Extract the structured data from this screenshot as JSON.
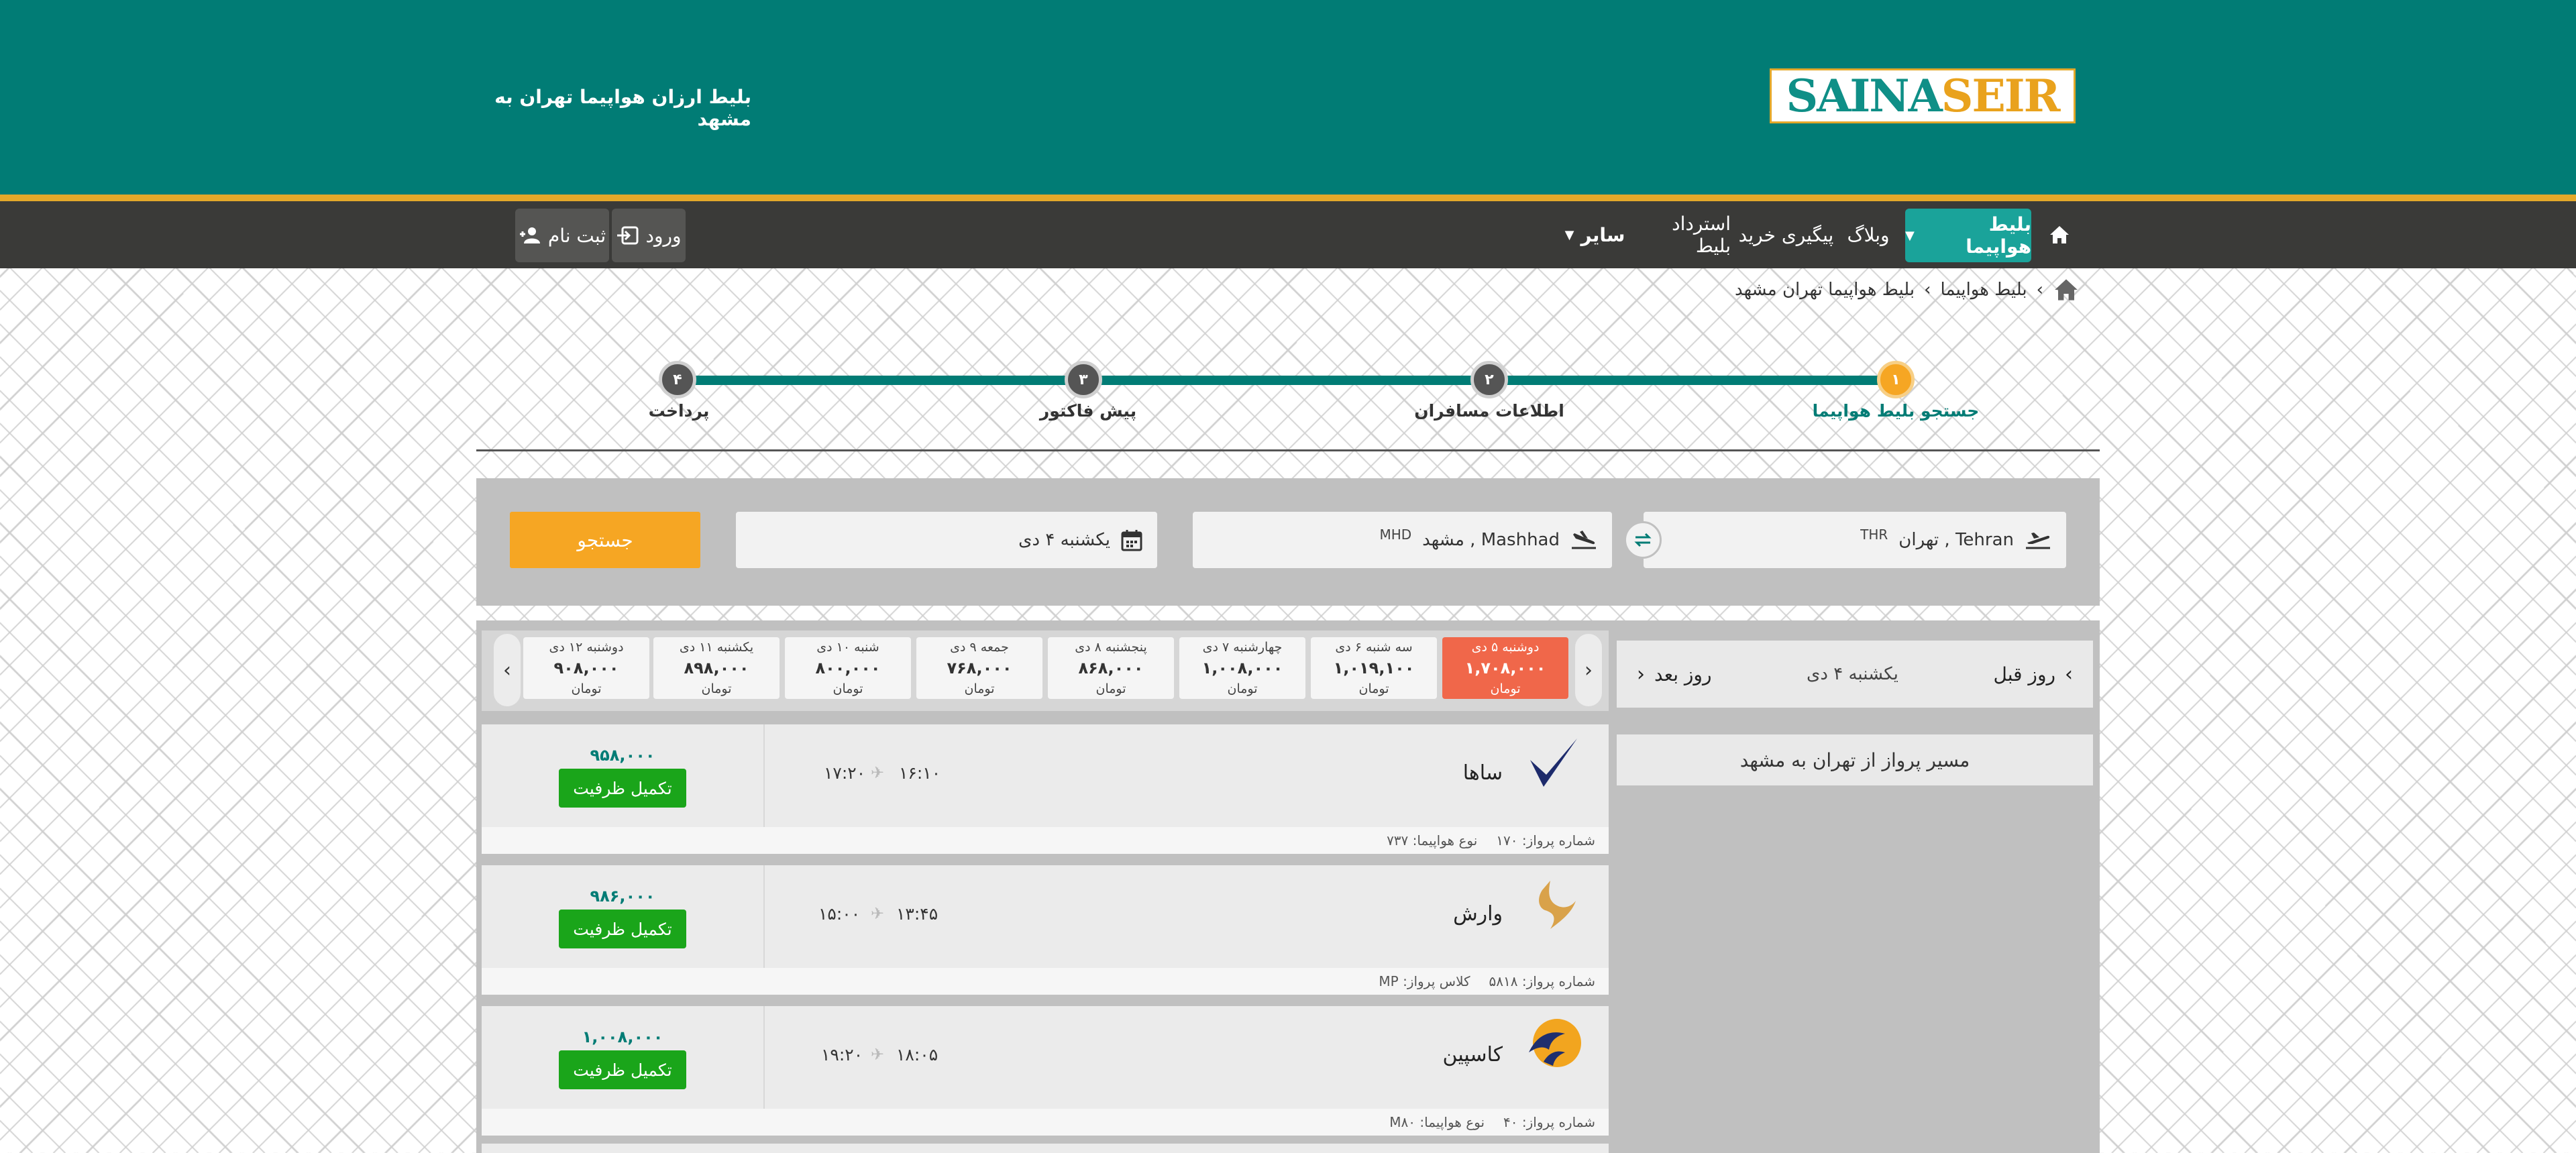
{
  "header": {
    "logo_left": "SAINA",
    "logo_right": "SEIR",
    "page_title": "بلیط ارزان هواپیما تهران به مشهد",
    "colors": {
      "primary": "#017c75",
      "accent": "#f6a623",
      "stripe": "#e3a82a"
    }
  },
  "nav": {
    "home_icon": "home-icon",
    "flight_ticket": "بلیط هواپیما",
    "blog": "وبلاگ",
    "track_purchase": "پیگیری خرید",
    "refund": "استرداد بلیط",
    "other": "سایر",
    "login": "ورود",
    "register": "ثبت نام"
  },
  "breadcrumb": {
    "level1": "بلیط هواپیما",
    "level2": "بلیط هواپیما تهران مشهد"
  },
  "stepper": {
    "steps": [
      {
        "num": "۱",
        "label": "جستجو بلیط هواپیما",
        "active": true
      },
      {
        "num": "۲",
        "label": "اطلاعات مسافران",
        "active": false
      },
      {
        "num": "۳",
        "label": "پیش فاکتور",
        "active": false
      },
      {
        "num": "۴",
        "label": "پرداخت",
        "active": false
      }
    ]
  },
  "search": {
    "origin": "Tehran , تهران",
    "origin_code": "THR",
    "destination": "Mashhad , مشهد",
    "destination_code": "MHD",
    "date": "یکشنبه ۴ دی",
    "button": "جستجو"
  },
  "sidebar": {
    "prev_day": "روز قبل",
    "current_day": "یکشنبه ۴ دی",
    "next_day": "روز بعد",
    "route": "مسیر پرواز از تهران به مشهد"
  },
  "date_strip": {
    "currency": "تومان",
    "days": [
      {
        "label": "دوشنبه ۵ دی",
        "price": "۱,۷۰۸,۰۰۰",
        "selected": true
      },
      {
        "label": "سه شنبه ۶ دی",
        "price": "۱,۰۱۹,۱۰۰",
        "selected": false
      },
      {
        "label": "چهارشنبه ۷ دی",
        "price": "۱,۰۰۸,۰۰۰",
        "selected": false
      },
      {
        "label": "پنجشنبه ۸ دی",
        "price": "۸۶۸,۰۰۰",
        "selected": false
      },
      {
        "label": "جمعه ۹ دی",
        "price": "۷۶۸,۰۰۰",
        "selected": false
      },
      {
        "label": "شنبه ۱۰ دی",
        "price": "۸۰۰,۰۰۰",
        "selected": false
      },
      {
        "label": "یکشنبه ۱۱ دی",
        "price": "۸۹۸,۰۰۰",
        "selected": false
      },
      {
        "label": "دوشنبه ۱۲ دی",
        "price": "۹۰۸,۰۰۰",
        "selected": false
      }
    ]
  },
  "flights": [
    {
      "airline": "ساها",
      "logo_icon": "saha-logo-icon",
      "depart": "۱۶:۱۰",
      "arrive": "۱۷:۲۰",
      "price": "۹۵۸,۰۰۰",
      "button": "تکمیل ظرفیت",
      "flight_no_label": "شماره پرواز:",
      "flight_no": "۱۷۰",
      "extra_label": "نوع هواپیما:",
      "extra_value": "۷۳۷"
    },
    {
      "airline": "وارش",
      "logo_icon": "varesh-logo-icon",
      "depart": "۱۳:۴۵",
      "arrive": "۱۵:۰۰",
      "price": "۹۸۶,۰۰۰",
      "button": "تکمیل ظرفیت",
      "flight_no_label": "شماره پرواز:",
      "flight_no": "۵۸۱۸",
      "extra_label": "کلاس پرواز:",
      "extra_value": "MP"
    },
    {
      "airline": "کاسپین",
      "logo_icon": "caspian-logo-icon",
      "depart": "۱۸:۰۵",
      "arrive": "۱۹:۲۰",
      "price": "۱,۰۰۸,۰۰۰",
      "button": "تکمیل ظرفیت",
      "flight_no_label": "شماره پرواز:",
      "flight_no": "۴۰",
      "extra_label": "نوع هواپیما:",
      "extra_value": "M۸۰"
    }
  ]
}
